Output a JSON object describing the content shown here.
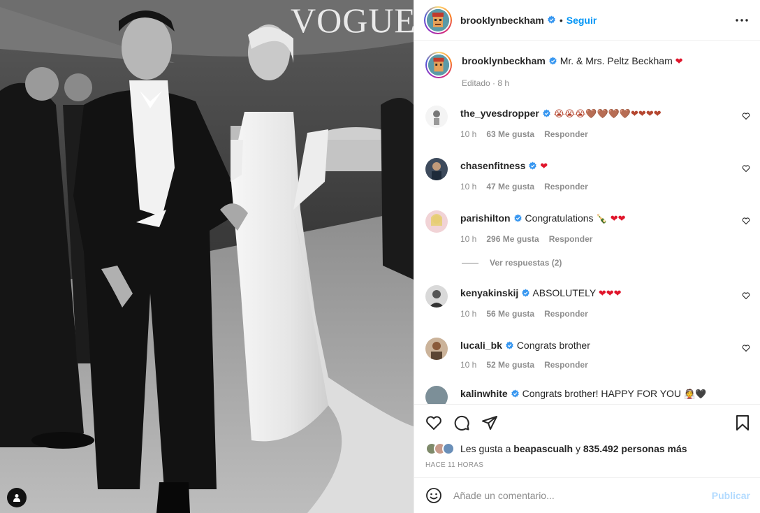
{
  "photo": {
    "masthead": "VOGUE",
    "tag_icon": "user-tag-icon"
  },
  "header": {
    "username": "brooklynbeckham",
    "separator": "•",
    "follow_label": "Seguir",
    "more_icon": "more-horizontal-icon"
  },
  "caption": {
    "username": "brooklynbeckham",
    "text": "Mr. & Mrs. Peltz Beckham",
    "emoji": "❤",
    "edited": "Editado",
    "time": "8 h"
  },
  "comments": [
    {
      "username": "the_yvesdropper",
      "verified": true,
      "text": "",
      "emoji": "😭😭😭🤎🤎🤎🤎❤❤❤❤",
      "time": "10 h",
      "likes": "63 Me gusta",
      "reply": "Responder"
    },
    {
      "username": "chasenfitness",
      "verified": true,
      "text": "",
      "emoji": "❤",
      "time": "10 h",
      "likes": "47 Me gusta",
      "reply": "Responder"
    },
    {
      "username": "parishilton",
      "verified": true,
      "text": "Congratulations",
      "emoji": "🍾 ❤❤",
      "time": "10 h",
      "likes": "296 Me gusta",
      "reply": "Responder"
    },
    {
      "username": "kenyakinskij",
      "verified": true,
      "text": "ABSOLUTELY",
      "emoji": "❤❤❤",
      "time": "10 h",
      "likes": "56 Me gusta",
      "reply": "Responder"
    },
    {
      "username": "lucali_bk",
      "verified": true,
      "text": "Congrats brother",
      "emoji": "",
      "time": "10 h",
      "likes": "52 Me gusta",
      "reply": "Responder"
    }
  ],
  "view_replies": "Ver respuestas (2)",
  "partial_comment": {
    "username": "kalinwhite",
    "text": "Congrats brother! HAPPY FOR YOU",
    "emoji": "👰🖤"
  },
  "actions": {
    "like_icon": "heart-icon",
    "comment_icon": "comment-icon",
    "share_icon": "share-icon",
    "save_icon": "bookmark-icon"
  },
  "likes": {
    "prefix": "Les gusta a",
    "first_user": "beapascualh",
    "conj": "y",
    "others": "835.492 personas más"
  },
  "timestamp": "HACE 11 HORAS",
  "add_comment": {
    "placeholder": "Añade un comentario...",
    "publish_label": "Publicar",
    "emoji_icon": "smiley-icon"
  },
  "colors": {
    "accent": "#0095f6",
    "verified": "#3897f0",
    "heart": "#e0152b",
    "muted": "#8e8e8e"
  }
}
